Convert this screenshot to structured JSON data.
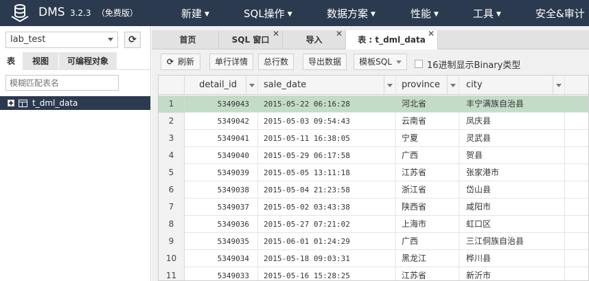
{
  "app": {
    "brand": "DMS",
    "version": "3.2.3",
    "edition": "（免费版）"
  },
  "menu": [
    "新建",
    "SQL操作",
    "数据方案",
    "性能",
    "工具",
    "安全&审计"
  ],
  "sidebar": {
    "database": "lab_test",
    "tabs": [
      "表",
      "视图",
      "可编程对象"
    ],
    "filter_placeholder": "模糊匹配表名",
    "tree": [
      {
        "label": "t_dml_data"
      }
    ]
  },
  "tabs": [
    {
      "label": "首页",
      "closable": false
    },
    {
      "label": "SQL 窗口",
      "closable": true
    },
    {
      "label": "导入",
      "closable": true
    },
    {
      "label": "表 : t_dml_data",
      "closable": true
    }
  ],
  "toolbar": {
    "refresh": "刷新",
    "row_detail": "单行详情",
    "row_count": "总行数",
    "export": "导出数据",
    "template_sql": "模板SQL",
    "binary_hex": "16进制显示Binary类型"
  },
  "grid": {
    "columns": [
      "detail_id",
      "sale_date",
      "province",
      "city"
    ],
    "rows": [
      {
        "n": "1",
        "detail_id": "5349043",
        "sale_date": "2015-05-22 06:16:28",
        "province": "河北省",
        "city": "丰宁满族自治县"
      },
      {
        "n": "2",
        "detail_id": "5349042",
        "sale_date": "2015-05-03 09:54:43",
        "province": "云南省",
        "city": "凤庆县"
      },
      {
        "n": "3",
        "detail_id": "5349041",
        "sale_date": "2015-05-11 16:38:05",
        "province": "宁夏",
        "city": "灵武县"
      },
      {
        "n": "4",
        "detail_id": "5349040",
        "sale_date": "2015-05-29 06:17:58",
        "province": "广西",
        "city": "贺县"
      },
      {
        "n": "5",
        "detail_id": "5349039",
        "sale_date": "2015-05-05 13:11:18",
        "province": "江苏省",
        "city": "张家港市"
      },
      {
        "n": "6",
        "detail_id": "5349038",
        "sale_date": "2015-05-04 21:23:58",
        "province": "浙江省",
        "city": "岱山县"
      },
      {
        "n": "7",
        "detail_id": "5349037",
        "sale_date": "2015-05-02 03:43:38",
        "province": "陕西省",
        "city": "咸阳市"
      },
      {
        "n": "8",
        "detail_id": "5349036",
        "sale_date": "2015-05-27 07:21:02",
        "province": "上海市",
        "city": "虹口区"
      },
      {
        "n": "9",
        "detail_id": "5349035",
        "sale_date": "2015-06-01 01:24:29",
        "province": "广西",
        "city": "三江侗族自治县"
      },
      {
        "n": "10",
        "detail_id": "5349034",
        "sale_date": "2015-05-18 09:03:31",
        "province": "黑龙江",
        "city": "桦川县"
      },
      {
        "n": "11",
        "detail_id": "5349033",
        "sale_date": "2015-05-16 15:28:25",
        "province": "江苏省",
        "city": "新沂市"
      }
    ]
  },
  "colors": {
    "topbar": "#2b3a4e",
    "selected_row": "#c3dcc8"
  }
}
